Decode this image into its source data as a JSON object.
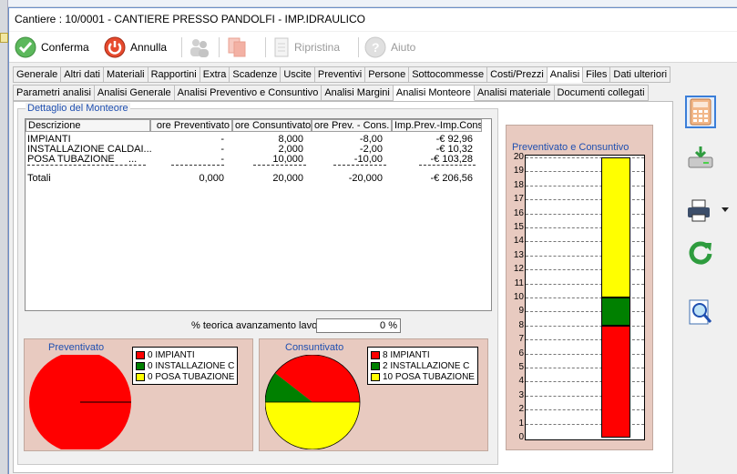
{
  "window": {
    "title": "Cantiere : 10/0001 - CANTIERE PRESSO PANDOLFI - IMP.IDRAULICO"
  },
  "toolbar": {
    "confirm": "Conferma",
    "cancel": "Annulla",
    "restore": "Ripristina",
    "help": "Aiuto"
  },
  "tabs_main": [
    "Generale",
    "Altri dati",
    "Materiali",
    "Rapportini",
    "Extra",
    "Scadenze",
    "Uscite",
    "Preventivi",
    "Persone",
    "Sottocommesse",
    "Costi/Prezzi",
    "Analisi",
    "Files",
    "Dati ulteriori"
  ],
  "tabs_main_active": 11,
  "tabs_sub": [
    "Parametri analisi",
    "Analisi Generale",
    "Analisi Preventivo e Consuntivo",
    "Analisi Margini",
    "Analisi Monteore",
    "Analisi materiale",
    "Documenti collegati"
  ],
  "tabs_sub_active": 4,
  "section": {
    "title": "Dettaglio del Monteore"
  },
  "table": {
    "headers": [
      "Descrizione",
      "ore Preventivato",
      "ore Consuntivato",
      "ore Prev. - Cons.",
      "Imp.Prev.-Imp.Cons."
    ],
    "rows": [
      {
        "desc": "IMPIANTI",
        "prev": "-",
        "cons": "8,000",
        "diff": "-8,00",
        "imp": "-€ 92,96"
      },
      {
        "desc": "INSTALLAZIONE CALDAI...",
        "prev": "-",
        "cons": "2,000",
        "diff": "-2,00",
        "imp": "-€ 10,32"
      },
      {
        "desc": "POSA TUBAZIONE     ...",
        "prev": "-",
        "cons": "10,000",
        "diff": "-10,00",
        "imp": "-€ 103,28"
      }
    ],
    "totals": {
      "desc": "Totali",
      "prev": "0,000",
      "cons": "20,000",
      "diff": "-20,000",
      "imp": "-€ 206,56"
    }
  },
  "progress": {
    "label": "% teorica avanzamento lavori",
    "value": "0 %"
  },
  "pie_preventivato": {
    "title": "Preventivato",
    "legend": [
      "0 IMPIANTI",
      "0 INSTALLAZIONE C",
      "0 POSA TUBAZIONE"
    ]
  },
  "pie_consuntivato": {
    "title": "Consuntivato",
    "legend": [
      "8 IMPIANTI",
      "2 INSTALLAZIONE C",
      "10 POSA TUBAZIONE"
    ]
  },
  "colors": {
    "impianti": "#ff0000",
    "installazione": "#008000",
    "posa": "#ffff00",
    "chart_bg": "#e8cac0",
    "title_blue": "#1f4fb0"
  },
  "chart_data": [
    {
      "type": "pie",
      "title": "Preventivato",
      "categories": [
        "IMPIANTI",
        "INSTALLAZIONE C",
        "POSA TUBAZIONE"
      ],
      "values": [
        0,
        0,
        0
      ]
    },
    {
      "type": "pie",
      "title": "Consuntivato",
      "categories": [
        "IMPIANTI",
        "INSTALLAZIONE C",
        "POSA TUBAZIONE"
      ],
      "values": [
        8,
        2,
        10
      ]
    },
    {
      "type": "bar",
      "stacked": true,
      "title": "Preventivato e Consuntivo",
      "ylim": [
        0,
        20
      ],
      "yticks": [
        "0",
        "1",
        "2",
        "3",
        "4",
        "5",
        "6",
        "7",
        "8",
        "9",
        "10",
        "11",
        "12",
        "13",
        "14",
        "15",
        "16",
        "17",
        "18",
        "19",
        "20"
      ],
      "series": [
        {
          "name": "IMPIANTI",
          "values": [
            8
          ]
        },
        {
          "name": "INSTALLAZIONE C",
          "values": [
            2
          ]
        },
        {
          "name": "POSA TUBAZIONE",
          "values": [
            10
          ]
        }
      ],
      "grid": true
    }
  ],
  "sidebar_icons": [
    "calculator-icon",
    "drive-icon",
    "printer-icon",
    "refresh-icon",
    "search-icon"
  ]
}
